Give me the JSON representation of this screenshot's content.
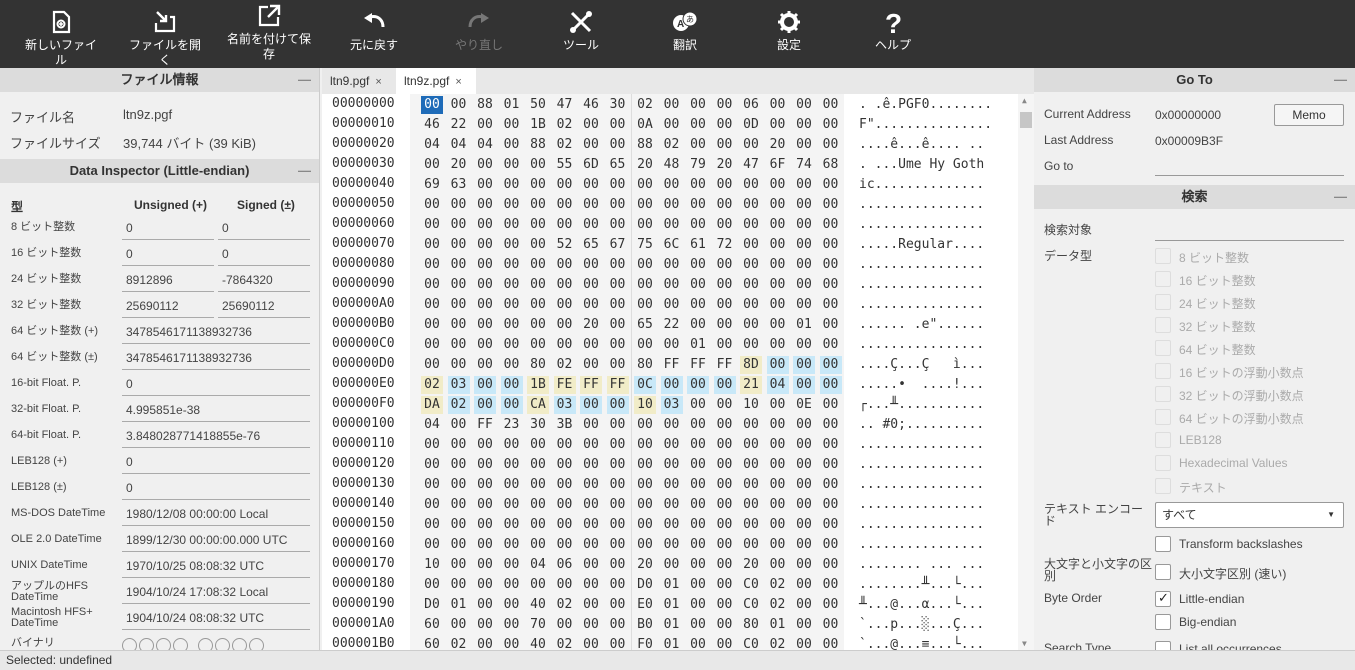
{
  "toolbar": {
    "new_file": "新しいファイル",
    "open_file": "ファイルを開く",
    "save_as": "名前を付けて保\n存",
    "undo": "元に戻す",
    "redo": "やり直し",
    "tools": "ツール",
    "translate": "翻訳",
    "settings": "設定",
    "help": "ヘルプ"
  },
  "file_info": {
    "header": "ファイル情報",
    "name_label": "ファイル名",
    "name_value": "ltn9z.pgf",
    "size_label": "ファイルサイズ",
    "size_value": "39,744 バイト (39 KiB)"
  },
  "inspector": {
    "header": "Data Inspector (Little-endian)",
    "col_type": "型",
    "col_unsigned": "Unsigned (+)",
    "col_signed": "Signed (±)",
    "rows": [
      {
        "label": "8 ビット整数",
        "u": "0",
        "s": "0"
      },
      {
        "label": "16 ビット整数",
        "u": "0",
        "s": "0"
      },
      {
        "label": "24 ビット整数",
        "u": "8912896",
        "s": "-7864320"
      },
      {
        "label": "32 ビット整数",
        "u": "25690112",
        "s": "25690112"
      },
      {
        "label": "64 ビット整数 (+)",
        "v": "3478546171138932736"
      },
      {
        "label": "64 ビット整数 (±)",
        "v": "3478546171138932736"
      },
      {
        "label": "16-bit Float. P.",
        "v": "0"
      },
      {
        "label": "32-bit Float. P.",
        "v": "4.995851e-38"
      },
      {
        "label": "64-bit Float. P.",
        "v": "3.848028771418855e-76"
      },
      {
        "label": "LEB128 (+)",
        "v": "0"
      },
      {
        "label": "LEB128 (±)",
        "v": "0"
      },
      {
        "label": "MS-DOS DateTime",
        "v": "1980/12/08 00:00:00 Local"
      },
      {
        "label": "OLE 2.0 DateTime",
        "v": "1899/12/30 00:00:00.000 UTC"
      },
      {
        "label": "UNIX DateTime",
        "v": "1970/10/25 08:08:32 UTC"
      },
      {
        "label": "アップルのHFS\nDateTime",
        "v": "1904/10/24 17:08:32 Local"
      },
      {
        "label": "Macintosh HFS+\nDateTime",
        "v": "1904/10/24 08:08:32 UTC"
      },
      {
        "label": "バイナリ",
        "v": ""
      }
    ]
  },
  "tabs": [
    {
      "label": "ltn9.pgf",
      "close": "×"
    },
    {
      "label": "ltn9z.pgf",
      "close": "×"
    }
  ],
  "hex": {
    "rows": [
      {
        "addr": "00000000",
        "bytes": [
          "00",
          "00",
          "88",
          "01",
          "50",
          "47",
          "46",
          "30",
          "02",
          "00",
          "00",
          "00",
          "06",
          "00",
          "00",
          "00"
        ],
        "text": ". .ê.PGF0........"
      },
      {
        "addr": "00000010",
        "bytes": [
          "46",
          "22",
          "00",
          "00",
          "1B",
          "02",
          "00",
          "00",
          "0A",
          "00",
          "00",
          "00",
          "0D",
          "00",
          "00",
          "00"
        ],
        "text": "F\"..............."
      },
      {
        "addr": "00000020",
        "bytes": [
          "04",
          "04",
          "04",
          "00",
          "88",
          "02",
          "00",
          "00",
          "88",
          "02",
          "00",
          "00",
          "00",
          "20",
          "00",
          "00"
        ],
        "text": "....ê...ê.... .."
      },
      {
        "addr": "00000030",
        "bytes": [
          "00",
          "20",
          "00",
          "00",
          "00",
          "55",
          "6D",
          "65",
          "20",
          "48",
          "79",
          "20",
          "47",
          "6F",
          "74",
          "68"
        ],
        "text": ". ...Ume Hy Goth"
      },
      {
        "addr": "00000040",
        "bytes": [
          "69",
          "63",
          "00",
          "00",
          "00",
          "00",
          "00",
          "00",
          "00",
          "00",
          "00",
          "00",
          "00",
          "00",
          "00",
          "00"
        ],
        "text": "ic.............."
      },
      {
        "addr": "00000050",
        "bytes": [
          "00",
          "00",
          "00",
          "00",
          "00",
          "00",
          "00",
          "00",
          "00",
          "00",
          "00",
          "00",
          "00",
          "00",
          "00",
          "00"
        ],
        "text": "................"
      },
      {
        "addr": "00000060",
        "bytes": [
          "00",
          "00",
          "00",
          "00",
          "00",
          "00",
          "00",
          "00",
          "00",
          "00",
          "00",
          "00",
          "00",
          "00",
          "00",
          "00"
        ],
        "text": "................"
      },
      {
        "addr": "00000070",
        "bytes": [
          "00",
          "00",
          "00",
          "00",
          "00",
          "52",
          "65",
          "67",
          "75",
          "6C",
          "61",
          "72",
          "00",
          "00",
          "00",
          "00"
        ],
        "text": ".....Regular...."
      },
      {
        "addr": "00000080",
        "bytes": [
          "00",
          "00",
          "00",
          "00",
          "00",
          "00",
          "00",
          "00",
          "00",
          "00",
          "00",
          "00",
          "00",
          "00",
          "00",
          "00"
        ],
        "text": "................"
      },
      {
        "addr": "00000090",
        "bytes": [
          "00",
          "00",
          "00",
          "00",
          "00",
          "00",
          "00",
          "00",
          "00",
          "00",
          "00",
          "00",
          "00",
          "00",
          "00",
          "00"
        ],
        "text": "................"
      },
      {
        "addr": "000000A0",
        "bytes": [
          "00",
          "00",
          "00",
          "00",
          "00",
          "00",
          "00",
          "00",
          "00",
          "00",
          "00",
          "00",
          "00",
          "00",
          "00",
          "00"
        ],
        "text": "................"
      },
      {
        "addr": "000000B0",
        "bytes": [
          "00",
          "00",
          "00",
          "00",
          "00",
          "00",
          "20",
          "00",
          "65",
          "22",
          "00",
          "00",
          "00",
          "00",
          "01",
          "00"
        ],
        "text": "...... .e\"......"
      },
      {
        "addr": "000000C0",
        "bytes": [
          "00",
          "00",
          "00",
          "00",
          "00",
          "00",
          "00",
          "00",
          "00",
          "00",
          "01",
          "00",
          "00",
          "00",
          "00",
          "00"
        ],
        "text": "................"
      },
      {
        "addr": "000000D0",
        "bytes": [
          "00",
          "00",
          "00",
          "00",
          "80",
          "02",
          "00",
          "00",
          "80",
          "FF",
          "FF",
          "FF",
          "8D",
          "00",
          "00",
          "00"
        ],
        "text": "....Ç...Ç   ì..."
      },
      {
        "addr": "000000E0",
        "bytes": [
          "02",
          "03",
          "00",
          "00",
          "1B",
          "FE",
          "FF",
          "FF",
          "0C",
          "00",
          "00",
          "00",
          "21",
          "04",
          "00",
          "00"
        ],
        "text": ".....•  ....!..."
      },
      {
        "addr": "000000F0",
        "bytes": [
          "DA",
          "02",
          "00",
          "00",
          "CA",
          "03",
          "00",
          "00",
          "10",
          "03",
          "00",
          "00",
          "10",
          "00",
          "0E",
          "00"
        ],
        "text": "┌...╨..........."
      },
      {
        "addr": "00000100",
        "bytes": [
          "04",
          "00",
          "FF",
          "23",
          "30",
          "3B",
          "00",
          "00",
          "00",
          "00",
          "00",
          "00",
          "00",
          "00",
          "00",
          "00"
        ],
        "text": ".. #0;.........."
      },
      {
        "addr": "00000110",
        "bytes": [
          "00",
          "00",
          "00",
          "00",
          "00",
          "00",
          "00",
          "00",
          "00",
          "00",
          "00",
          "00",
          "00",
          "00",
          "00",
          "00"
        ],
        "text": "................"
      },
      {
        "addr": "00000120",
        "bytes": [
          "00",
          "00",
          "00",
          "00",
          "00",
          "00",
          "00",
          "00",
          "00",
          "00",
          "00",
          "00",
          "00",
          "00",
          "00",
          "00"
        ],
        "text": "................"
      },
      {
        "addr": "00000130",
        "bytes": [
          "00",
          "00",
          "00",
          "00",
          "00",
          "00",
          "00",
          "00",
          "00",
          "00",
          "00",
          "00",
          "00",
          "00",
          "00",
          "00"
        ],
        "text": "................"
      },
      {
        "addr": "00000140",
        "bytes": [
          "00",
          "00",
          "00",
          "00",
          "00",
          "00",
          "00",
          "00",
          "00",
          "00",
          "00",
          "00",
          "00",
          "00",
          "00",
          "00"
        ],
        "text": "................"
      },
      {
        "addr": "00000150",
        "bytes": [
          "00",
          "00",
          "00",
          "00",
          "00",
          "00",
          "00",
          "00",
          "00",
          "00",
          "00",
          "00",
          "00",
          "00",
          "00",
          "00"
        ],
        "text": "................"
      },
      {
        "addr": "00000160",
        "bytes": [
          "00",
          "00",
          "00",
          "00",
          "00",
          "00",
          "00",
          "00",
          "00",
          "00",
          "00",
          "00",
          "00",
          "00",
          "00",
          "00"
        ],
        "text": "................"
      },
      {
        "addr": "00000170",
        "bytes": [
          "10",
          "00",
          "00",
          "00",
          "04",
          "06",
          "00",
          "00",
          "20",
          "00",
          "00",
          "00",
          "20",
          "00",
          "00",
          "00"
        ],
        "text": "........ ... ..."
      },
      {
        "addr": "00000180",
        "bytes": [
          "00",
          "00",
          "00",
          "00",
          "00",
          "00",
          "00",
          "00",
          "D0",
          "01",
          "00",
          "00",
          "C0",
          "02",
          "00",
          "00"
        ],
        "text": "........╨...└..."
      },
      {
        "addr": "00000190",
        "bytes": [
          "D0",
          "01",
          "00",
          "00",
          "40",
          "02",
          "00",
          "00",
          "E0",
          "01",
          "00",
          "00",
          "C0",
          "02",
          "00",
          "00"
        ],
        "text": "╨...@...α...└..."
      },
      {
        "addr": "000001A0",
        "bytes": [
          "60",
          "00",
          "00",
          "00",
          "70",
          "00",
          "00",
          "00",
          "B0",
          "01",
          "00",
          "00",
          "80",
          "01",
          "00",
          "00"
        ],
        "text": "`...p...░...Ç..."
      },
      {
        "addr": "000001B0",
        "bytes": [
          "60",
          "02",
          "00",
          "00",
          "40",
          "02",
          "00",
          "00",
          "F0",
          "01",
          "00",
          "00",
          "C0",
          "02",
          "00",
          "00"
        ],
        "text": "`...@...≡...└..."
      }
    ]
  },
  "goto": {
    "header": "Go To",
    "current_label": "Current Address",
    "current_value": "0x00000000",
    "memo_button": "Memo",
    "last_label": "Last Address",
    "last_value": "0x00009B3F",
    "goto_label": "Go to",
    "goto_value": ""
  },
  "search": {
    "header": "検索",
    "target_label": "検索対象",
    "target_value": "",
    "data_type_label": "データ型",
    "data_types": [
      "8 ビット整数",
      "16 ビット整数",
      "24 ビット整数",
      "32 ビット整数",
      "64 ビット整数",
      "16 ビットの浮動小数点",
      "32 ビットの浮動小数点",
      "64 ビットの浮動小数点",
      "LEB128",
      "Hexadecimal Values",
      "テキスト"
    ],
    "encoding_label": "テキスト エンコー\nド",
    "encoding_value": "すべて",
    "transform_label": "Transform backslashes",
    "case_label": "大文字と小文字の区\n別",
    "case_option": "大小文字区別 (速い)",
    "byte_order_label": "Byte Order",
    "little_endian": "Little-endian",
    "big_endian": "Big-endian",
    "search_type_label": "Search Type",
    "search_type_option": "List all occurrences"
  },
  "status": {
    "text": "Selected: undefined"
  }
}
